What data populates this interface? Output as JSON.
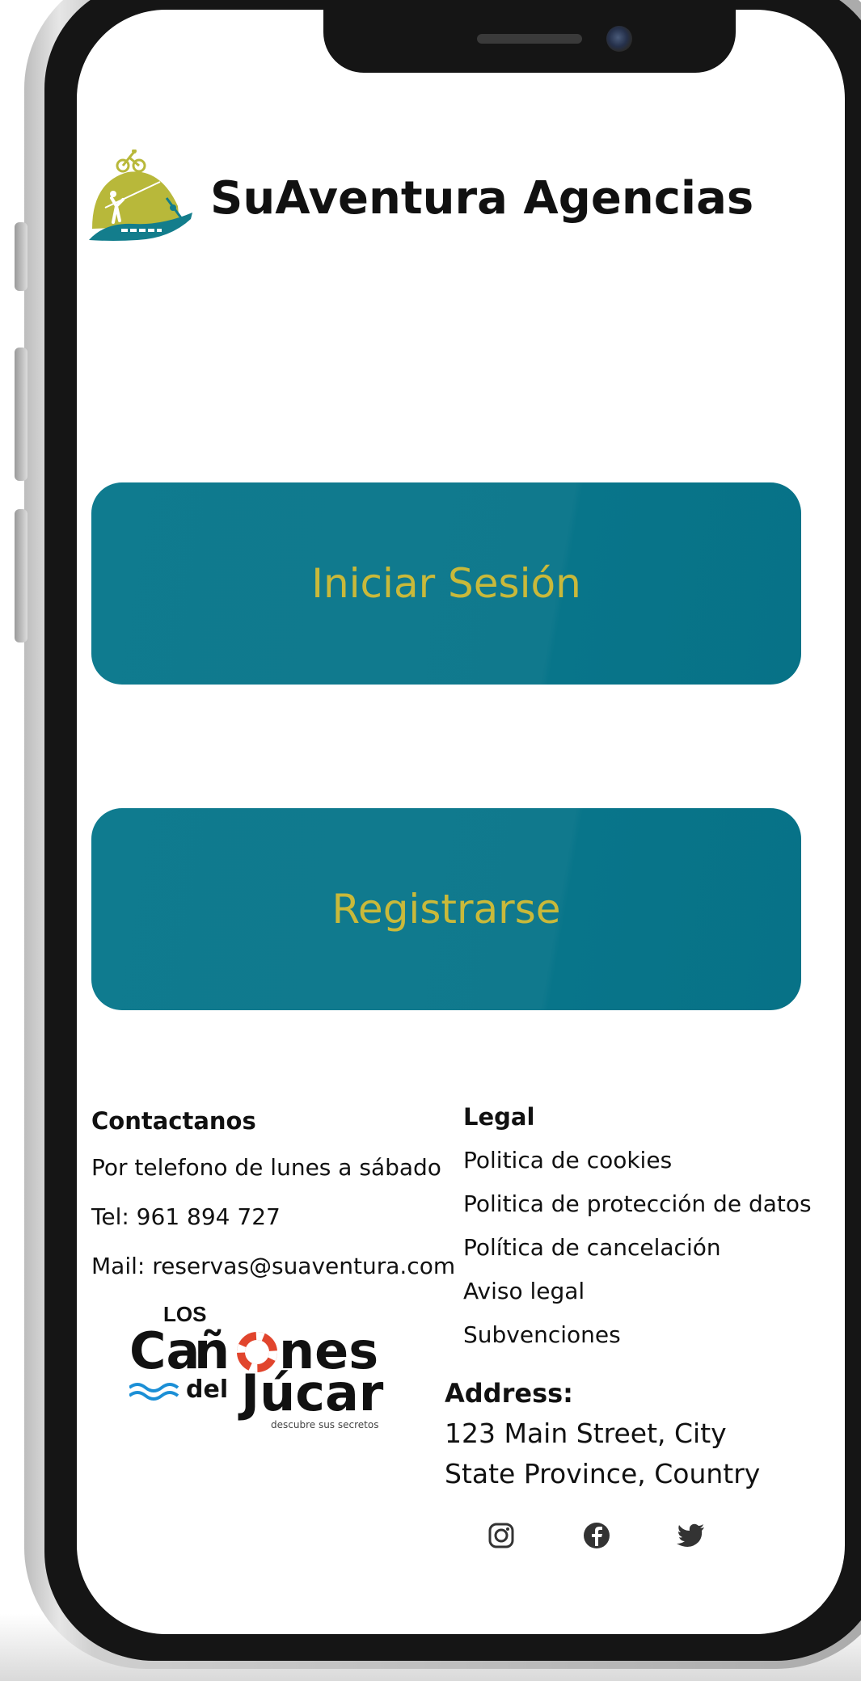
{
  "brand": {
    "name": "SuAventura Agencias",
    "logo_icon": "adventure-logo-icon"
  },
  "actions": {
    "login_label": "Iniciar Sesión",
    "register_label": "Registrarse"
  },
  "contact": {
    "heading": "Contactanos",
    "lines": [
      "Por telefono de lunes a sábado",
      "Tel: 961 894 727",
      "Mail: reservas@suaventura.com"
    ]
  },
  "legal": {
    "heading": "Legal",
    "links": [
      "Politica de cookies",
      "Politica de protección de datos",
      "Política de cancelación",
      "Aviso legal",
      "Subvenciones"
    ]
  },
  "partner": {
    "top": "LOS",
    "name_line1": "Cañones",
    "name_line2": "Júcar",
    "del": "del",
    "tagline": "descubre sus secretos"
  },
  "address": {
    "heading": "Address:",
    "line1": "123 Main Street, City",
    "line2": "State Province, Country"
  },
  "social": {
    "icons": [
      "instagram-icon",
      "facebook-icon",
      "twitter-icon"
    ]
  },
  "colors": {
    "button_bg": "#10798d",
    "button_text": "#c9b93a",
    "logo_olive": "#b8b83a",
    "logo_teal": "#137d8c"
  }
}
